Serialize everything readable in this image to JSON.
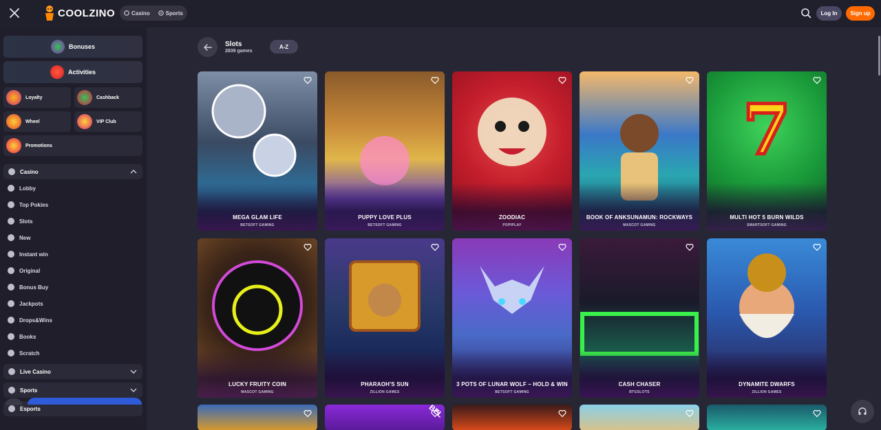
{
  "header": {
    "logo_text": "COOLZINO",
    "switch": [
      {
        "label": "Casino",
        "icon": "casino-chip-icon"
      },
      {
        "label": "Sports",
        "icon": "soccer-ball-icon"
      }
    ],
    "login_label": "Log In",
    "signup_label": "Sign up",
    "accent": "#ff6a00"
  },
  "sidebar": {
    "big_tiles": [
      {
        "label": "Bonuses",
        "icon": "gift-icon"
      },
      {
        "label": "Activities",
        "icon": "activities-icon"
      }
    ],
    "small_tiles": [
      {
        "label": "Loyalty",
        "icon": "crown-icon"
      },
      {
        "label": "Cashback",
        "icon": "cashback-icon"
      },
      {
        "label": "Wheel",
        "icon": "wheel-icon"
      },
      {
        "label": "VIP Club",
        "icon": "cocktail-icon"
      },
      {
        "label": "Promotions",
        "icon": "fire-icon"
      }
    ],
    "casino_label": "Casino",
    "casino_items": [
      "Lobby",
      "Top Pokies",
      "Slots",
      "New",
      "Instant win",
      "Original",
      "Bonus Buy",
      "Jackpots",
      "Drops&Wins",
      "Books",
      "Scratch"
    ],
    "live_casino_label": "Live Casino",
    "sports_label": "Sports",
    "esports_label": "Esports"
  },
  "main": {
    "title": "Slots",
    "subtitle": "2839 games",
    "sort_label": "A-Z",
    "games": [
      {
        "name": "MEGA GLAM LIFE",
        "provider": "BETSOFT GAMING"
      },
      {
        "name": "PUPPY LOVE PLUS",
        "provider": "BETSOFT GAMING"
      },
      {
        "name": "ZOODIAC",
        "provider": "POPIPLAY"
      },
      {
        "name": "BOOK OF ANKSUNAMUN: ROCKWAYS",
        "provider": "MASCOT GAMING"
      },
      {
        "name": "MULTI HOT 5 BURN WILDS",
        "provider": "SMARTSOFT GAMING"
      },
      {
        "name": "LUCKY FRUITY COIN",
        "provider": "MASCOT GAMING"
      },
      {
        "name": "PHARAOH'S SUN",
        "provider": "ZILLION GAMES"
      },
      {
        "name": "3 POTS OF LUNAR WOLF – HOLD & WIN",
        "provider": "BETSOFT GAMING"
      },
      {
        "name": "CASH CHASER",
        "provider": "BTGSLOTS"
      },
      {
        "name": "DYNAMITE DWARFS",
        "provider": "ZILLION GAMES"
      }
    ],
    "row3_badge": "BEL"
  }
}
